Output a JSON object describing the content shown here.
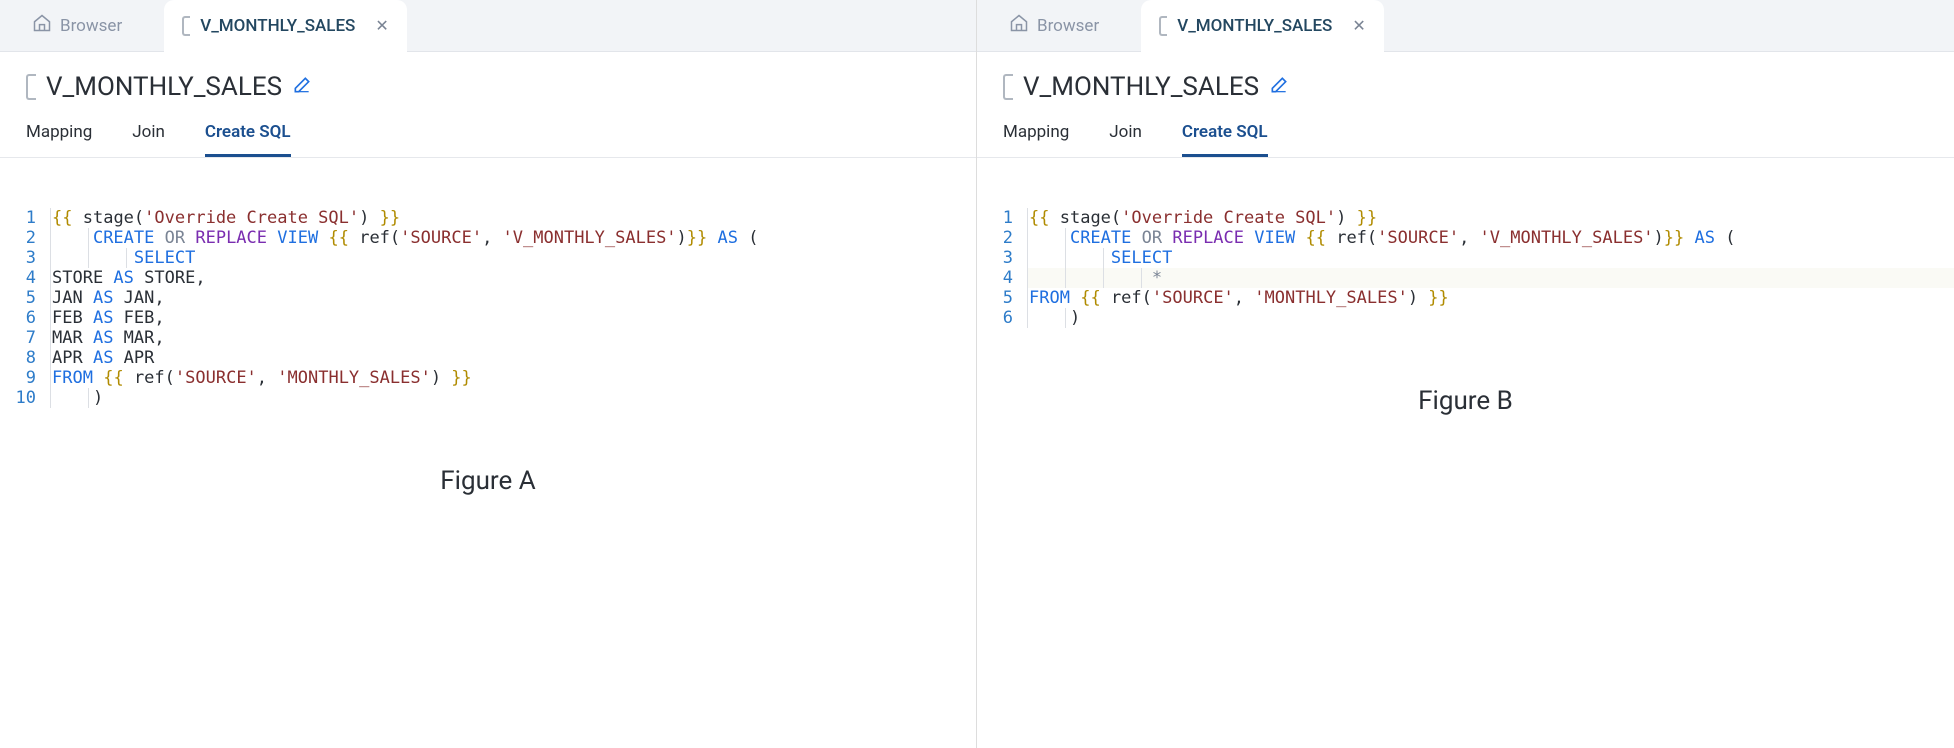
{
  "panels": [
    {
      "browser_label": "Browser",
      "tab_label": "V_MONTHLY_SALES",
      "title": "V_MONTHLY_SALES",
      "sub_tabs": {
        "mapping": "Mapping",
        "join": "Join",
        "create_sql": "Create SQL"
      },
      "active_sub_tab": "create_sql",
      "figure_label": "Figure A",
      "code": [
        {
          "n": "1",
          "indent": 0,
          "tokens": [
            [
              "delim",
              "{{"
            ],
            [
              "plain",
              " "
            ],
            [
              "fn",
              "stage"
            ],
            [
              "plain",
              "("
            ],
            [
              "str",
              "'Override Create SQL'"
            ],
            [
              "plain",
              ") "
            ],
            [
              "delim",
              "}}"
            ]
          ]
        },
        {
          "n": "2",
          "indent": 1,
          "tokens": [
            [
              "kw-blue",
              "CREATE"
            ],
            [
              "plain",
              " "
            ],
            [
              "kw-gray",
              "OR"
            ],
            [
              "plain",
              " "
            ],
            [
              "kw-purple",
              "REPLACE"
            ],
            [
              "plain",
              " "
            ],
            [
              "kw-blue",
              "VIEW"
            ],
            [
              "plain",
              " "
            ],
            [
              "delim",
              "{{"
            ],
            [
              "plain",
              " "
            ],
            [
              "fn",
              "ref"
            ],
            [
              "plain",
              "("
            ],
            [
              "str",
              "'SOURCE'"
            ],
            [
              "plain",
              ", "
            ],
            [
              "str",
              "'V_MONTHLY_SALES'"
            ],
            [
              "plain",
              ")"
            ],
            [
              "delim",
              "}}"
            ],
            [
              "plain",
              " "
            ],
            [
              "kw-blue",
              "AS"
            ],
            [
              "plain",
              " ("
            ]
          ]
        },
        {
          "n": "3",
          "indent": 2,
          "tokens": [
            [
              "kw-blue",
              "SELECT"
            ]
          ]
        },
        {
          "n": "4",
          "indent": 0,
          "tokens": [
            [
              "plain",
              "STORE "
            ],
            [
              "kw-blue",
              "AS"
            ],
            [
              "plain",
              " STORE,"
            ]
          ]
        },
        {
          "n": "5",
          "indent": 0,
          "tokens": [
            [
              "plain",
              "JAN "
            ],
            [
              "kw-blue",
              "AS"
            ],
            [
              "plain",
              " JAN,"
            ]
          ]
        },
        {
          "n": "6",
          "indent": 0,
          "tokens": [
            [
              "plain",
              "FEB "
            ],
            [
              "kw-blue",
              "AS"
            ],
            [
              "plain",
              " FEB,"
            ]
          ]
        },
        {
          "n": "7",
          "indent": 0,
          "tokens": [
            [
              "plain",
              "MAR "
            ],
            [
              "kw-blue",
              "AS"
            ],
            [
              "plain",
              " MAR,"
            ]
          ]
        },
        {
          "n": "8",
          "indent": 0,
          "tokens": [
            [
              "plain",
              "APR "
            ],
            [
              "kw-blue",
              "AS"
            ],
            [
              "plain",
              " APR"
            ]
          ]
        },
        {
          "n": "9",
          "indent": 0,
          "tokens": [
            [
              "kw-blue",
              "FROM"
            ],
            [
              "plain",
              " "
            ],
            [
              "delim",
              "{{"
            ],
            [
              "plain",
              " "
            ],
            [
              "fn",
              "ref"
            ],
            [
              "plain",
              "("
            ],
            [
              "str",
              "'SOURCE'"
            ],
            [
              "plain",
              ", "
            ],
            [
              "str",
              "'MONTHLY_SALES'"
            ],
            [
              "plain",
              ") "
            ],
            [
              "delim",
              "}}"
            ]
          ]
        },
        {
          "n": "10",
          "indent": 1,
          "tokens": [
            [
              "plain",
              ")"
            ]
          ]
        }
      ]
    },
    {
      "browser_label": "Browser",
      "tab_label": "V_MONTHLY_SALES",
      "title": "V_MONTHLY_SALES",
      "sub_tabs": {
        "mapping": "Mapping",
        "join": "Join",
        "create_sql": "Create SQL"
      },
      "active_sub_tab": "create_sql",
      "figure_label": "Figure B",
      "code": [
        {
          "n": "1",
          "indent": 0,
          "tokens": [
            [
              "delim",
              "{{"
            ],
            [
              "plain",
              " "
            ],
            [
              "fn",
              "stage"
            ],
            [
              "plain",
              "("
            ],
            [
              "str",
              "'Override Create SQL'"
            ],
            [
              "plain",
              ") "
            ],
            [
              "delim",
              "}}"
            ]
          ]
        },
        {
          "n": "2",
          "indent": 1,
          "tokens": [
            [
              "kw-blue",
              "CREATE"
            ],
            [
              "plain",
              " "
            ],
            [
              "kw-gray",
              "OR"
            ],
            [
              "plain",
              " "
            ],
            [
              "kw-purple",
              "REPLACE"
            ],
            [
              "plain",
              " "
            ],
            [
              "kw-blue",
              "VIEW"
            ],
            [
              "plain",
              " "
            ],
            [
              "delim",
              "{{"
            ],
            [
              "plain",
              " "
            ],
            [
              "fn",
              "ref"
            ],
            [
              "plain",
              "("
            ],
            [
              "str",
              "'SOURCE'"
            ],
            [
              "plain",
              ", "
            ],
            [
              "str",
              "'V_MONTHLY_SALES'"
            ],
            [
              "plain",
              ")"
            ],
            [
              "delim",
              "}}"
            ],
            [
              "plain",
              " "
            ],
            [
              "kw-blue",
              "AS"
            ],
            [
              "plain",
              " ("
            ]
          ]
        },
        {
          "n": "3",
          "indent": 2,
          "tokens": [
            [
              "kw-blue",
              "SELECT"
            ]
          ]
        },
        {
          "n": "4",
          "indent": 3,
          "highlight": true,
          "tokens": [
            [
              "kw-gray",
              "*"
            ]
          ]
        },
        {
          "n": "5",
          "indent": 0,
          "tokens": [
            [
              "kw-blue",
              "FROM"
            ],
            [
              "plain",
              " "
            ],
            [
              "delim",
              "{{"
            ],
            [
              "plain",
              " "
            ],
            [
              "fn",
              "ref"
            ],
            [
              "plain",
              "("
            ],
            [
              "str",
              "'SOURCE'"
            ],
            [
              "plain",
              ", "
            ],
            [
              "str",
              "'MONTHLY_SALES'"
            ],
            [
              "plain",
              ") "
            ],
            [
              "delim",
              "}}"
            ]
          ]
        },
        {
          "n": "6",
          "indent": 1,
          "tokens": [
            [
              "plain",
              ")"
            ]
          ]
        }
      ]
    }
  ]
}
